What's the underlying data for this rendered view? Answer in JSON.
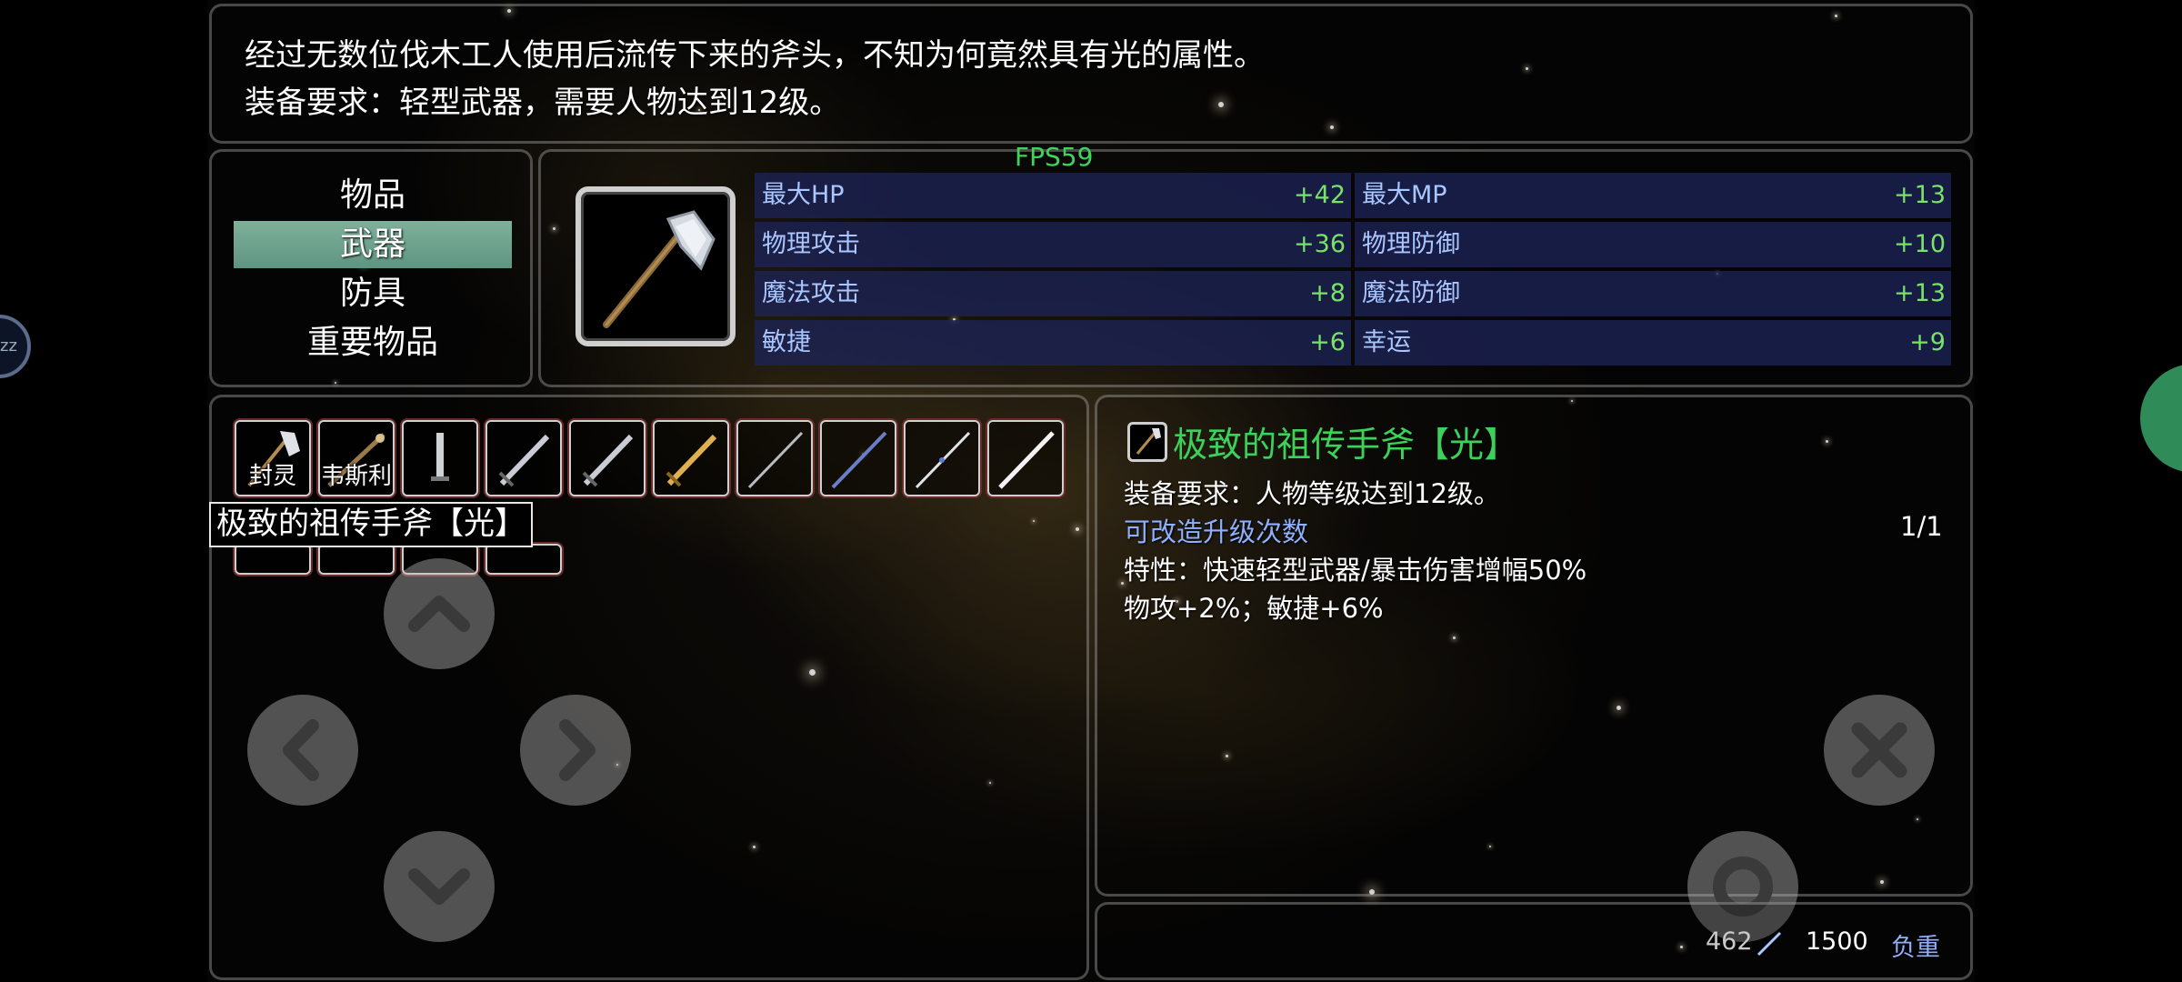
{
  "description": {
    "line1": "经过无数位伐木工人使用后流传下来的斧头，不知为何竟然具有光的属性。",
    "line2": "装备要求：轻型武器，需要人物达到12级。"
  },
  "fps": "FPS59",
  "categories": [
    {
      "label": "物品",
      "active": false
    },
    {
      "label": "武器",
      "active": true
    },
    {
      "label": "防具",
      "active": false
    },
    {
      "label": "重要物品",
      "active": false
    }
  ],
  "stats": [
    {
      "name": "最大HP",
      "value": "+42"
    },
    {
      "name": "最大MP",
      "value": "+13"
    },
    {
      "name": "物理攻击",
      "value": "+36"
    },
    {
      "name": "物理防御",
      "value": "+10"
    },
    {
      "name": "魔法攻击",
      "value": "+8"
    },
    {
      "name": "魔法防御",
      "value": "+13"
    },
    {
      "name": "敏捷",
      "value": "+6"
    },
    {
      "name": "幸运",
      "value": "+9"
    }
  ],
  "inventory": {
    "slots": [
      {
        "icon": "axe-icon",
        "label": "封灵"
      },
      {
        "icon": "staff-icon",
        "label": "韦斯利"
      },
      {
        "icon": "dagger-icon",
        "label": ""
      },
      {
        "icon": "sword-icon",
        "label": ""
      },
      {
        "icon": "sword-icon",
        "label": ""
      },
      {
        "icon": "golden-sword-icon",
        "label": ""
      },
      {
        "icon": "katana-icon",
        "label": ""
      },
      {
        "icon": "blue-blade-icon",
        "label": ""
      },
      {
        "icon": "spear-icon",
        "label": ""
      },
      {
        "icon": "white-blade-icon",
        "label": ""
      }
    ],
    "tooltip": "极致的祖传手斧【光】"
  },
  "detail": {
    "name": "极致的祖传手斧【光】",
    "requirement": "装备要求：人物等级达到12级。",
    "upgrade_label": "可改造升级次数",
    "upgrade_count": "1/1",
    "trait": "特性：快速轻型武器/暴击伤害增幅50%",
    "bonus": "物攻+2%；敏捷+6%"
  },
  "weight": {
    "current": "462",
    "max": "1500",
    "label": "负重"
  },
  "edge": {
    "left_bubble_text": "zz"
  },
  "colors": {
    "stat_name": "#a9c6ff",
    "stat_value": "#78e26a",
    "item_name": "#3cd25a",
    "highlight": "#6fa28d",
    "fps": "#3cd45a"
  }
}
